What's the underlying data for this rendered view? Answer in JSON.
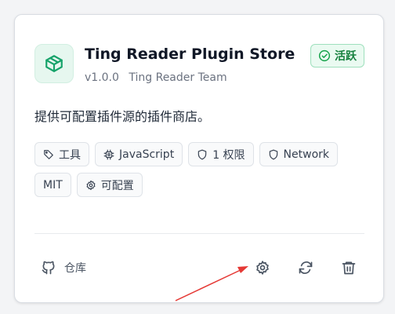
{
  "plugin": {
    "name": "Ting Reader Plugin Store",
    "version": "v1.0.0",
    "author": "Ting Reader Team",
    "status": "活跃",
    "description": "提供可配置插件源的插件商店。",
    "icon": "package-icon"
  },
  "tags": [
    {
      "icon": "tag-icon",
      "label": "工具"
    },
    {
      "icon": "cpu-icon",
      "label": "JavaScript"
    },
    {
      "icon": "shield-icon",
      "label": "1 权限"
    },
    {
      "icon": "shield-icon",
      "label": "Network"
    },
    {
      "icon": "",
      "label": "MIT"
    },
    {
      "icon": "gear-icon",
      "label": "可配置"
    }
  ],
  "footer": {
    "repo_label": "仓库",
    "repo_icon": "github-icon",
    "actions": [
      "settings",
      "refresh",
      "delete"
    ]
  },
  "colors": {
    "accent": "#15803d",
    "icon_bg": "#e6f7ef",
    "annotation": "#e53935"
  }
}
